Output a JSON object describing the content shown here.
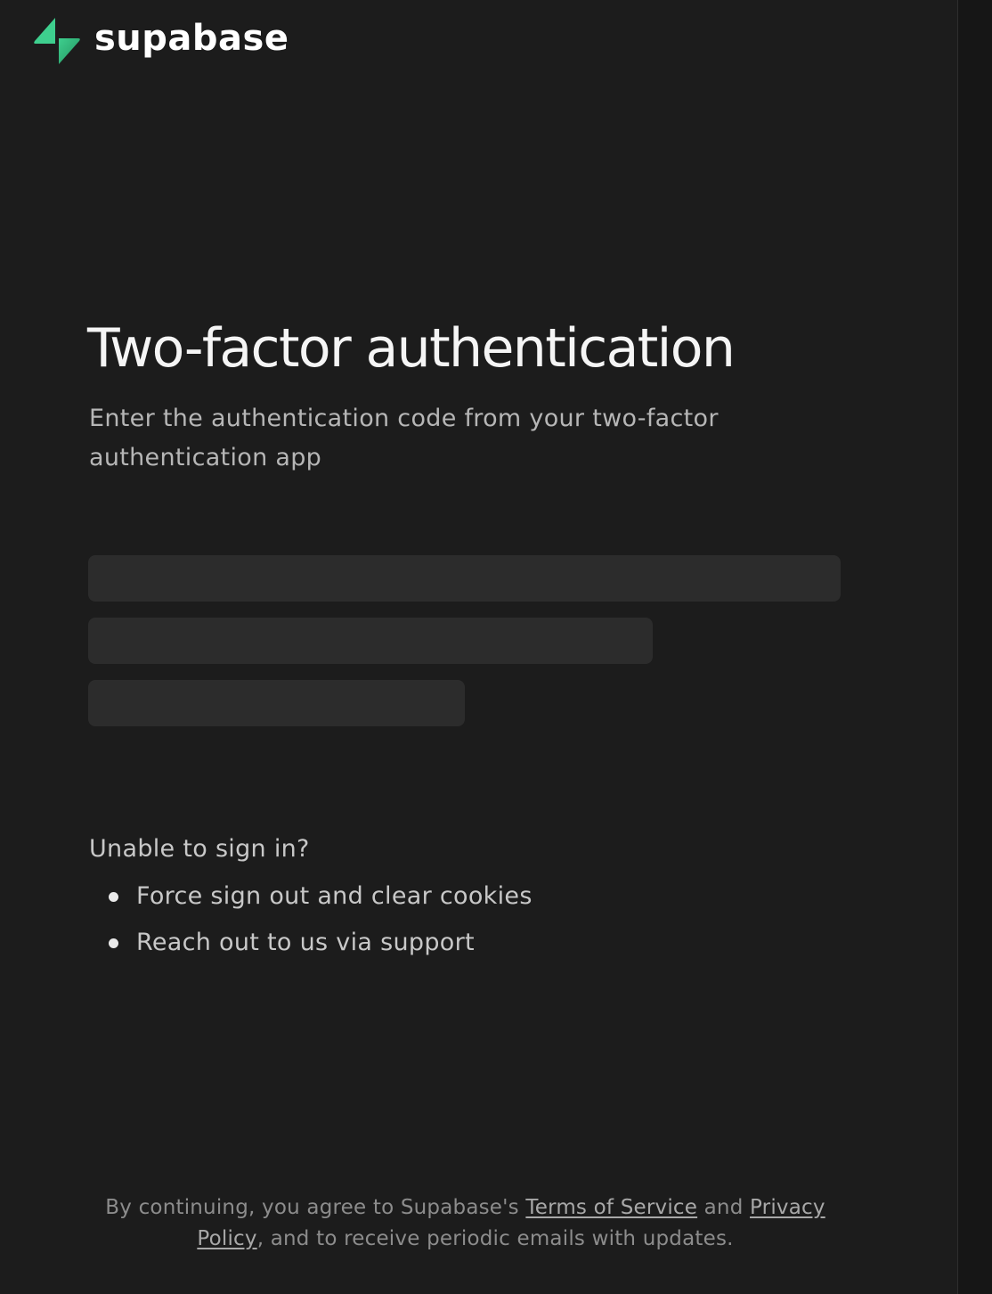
{
  "brand": {
    "name": "supabase",
    "logo_icon": "supabase-bolt-icon",
    "accent_color": "#3ecf8e"
  },
  "page": {
    "title": "Two-factor authentication",
    "subtitle": "Enter the authentication code from your two-factor authentication app"
  },
  "loading_placeholders": {
    "count": 3,
    "relative_widths": [
      1.0,
      0.75,
      0.5
    ]
  },
  "help": {
    "title": "Unable to sign in?",
    "items": [
      {
        "label": "Force sign out and clear cookies"
      },
      {
        "label": "Reach out to us via support"
      }
    ]
  },
  "footer": {
    "prefix": "By continuing, you agree to Supabase's ",
    "terms_link": "Terms of Service",
    "middle": " and ",
    "privacy_link": "Privacy Policy",
    "suffix": ", and to receive periodic emails with updates."
  }
}
